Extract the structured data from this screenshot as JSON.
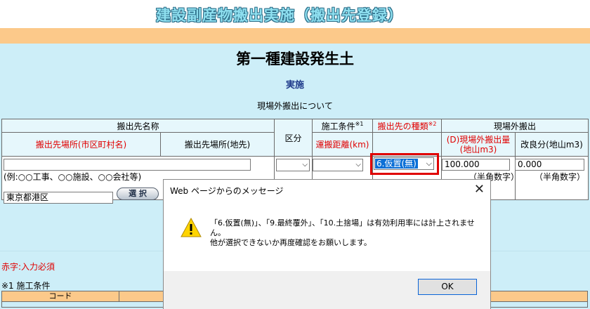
{
  "app_title": "建設副産物搬出実施（搬出先登録）",
  "main_heading": "第一種建設発生土",
  "sub_heading": "実施",
  "section_label": "現場外搬出について",
  "table": {
    "h_dest_name": "搬出先名称",
    "h_dest_muni": "搬出先場所(市区町村名)",
    "h_dest_addr": "搬出先場所(地先)",
    "h_kubun": "区分",
    "h_condition": "施工条件",
    "h_condition_note": "※1",
    "h_distance": "運搬距離(km)",
    "h_dest_type": "搬出先の種類",
    "h_dest_type_note": "※2",
    "h_offsite": "現場外搬出",
    "h_offsite_qty": "(D)現場外搬出量(地山m3)",
    "h_improve": "改良分(地山m3)"
  },
  "row": {
    "example_text": "(例:○○工事、○○施設、○○会社等)",
    "muni_value": "東京都港区",
    "select_button": "選 択",
    "dest_type_value": "6.仮置(無)",
    "qty_value": "100.000",
    "improve_value": "0.000",
    "halfwidth_note": "（半角数字）"
  },
  "footnotes": {
    "required": "赤字:入力必須",
    "note1": "※1 施工条件",
    "code_header": "コード"
  },
  "dialog": {
    "title": "Web ページからのメッセージ",
    "line1": "「6.仮置(無)」、「9.最終覆外」、「10.土捨場」は有効利用率には計上されませ",
    "line2": "ん。",
    "line3": "他が選択できないか再度確認をお願いします。",
    "ok_label": "OK",
    "icon": "warning-icon"
  }
}
